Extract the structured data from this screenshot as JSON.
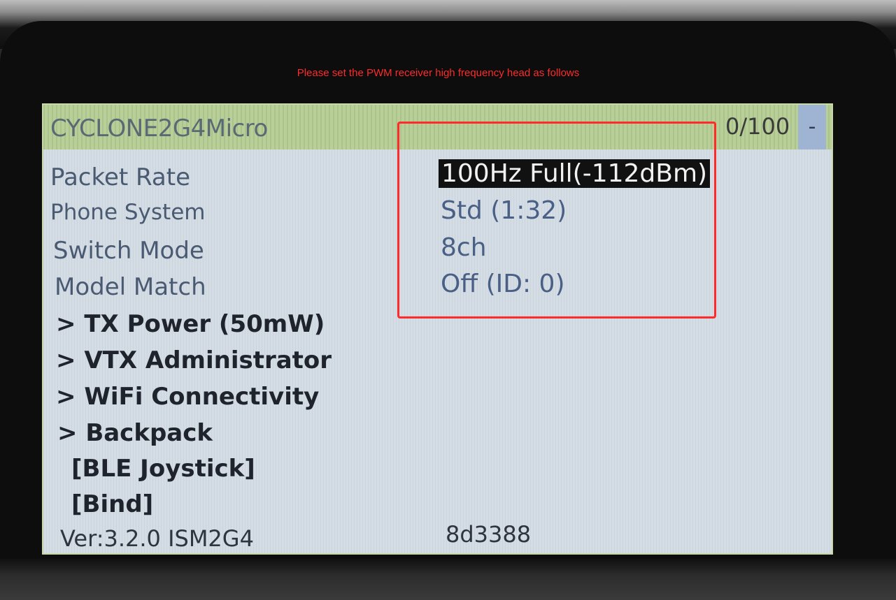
{
  "caption": "Please set the PWM receiver high frequency head as follows",
  "header": {
    "device_name": "CYCLONE2G4Micro",
    "counter": "0/100",
    "minus": "-"
  },
  "settings": [
    {
      "label": "Packet Rate",
      "value": "100Hz Full(-112dBm)",
      "selected": true
    },
    {
      "label": "Phone System",
      "value": "Std (1:32)"
    },
    {
      "label": "Switch Mode",
      "value": "8ch"
    },
    {
      "label": "Model Match",
      "value": "Off (ID: 0)"
    }
  ],
  "submenus": [
    "> TX Power (50mW)",
    "> VTX Administrator",
    "> WiFi Connectivity",
    "> Backpack",
    "[BLE Joystick]",
    "[Bind]"
  ],
  "footer": {
    "version": "Ver:3.2.0 ISM2G4",
    "hash": "8d3388"
  },
  "colors": {
    "annotation": "#ff2a2a",
    "header_bg": "#b8cf97",
    "screen_bg": "#d4dde4",
    "selection_bg": "#111111"
  }
}
